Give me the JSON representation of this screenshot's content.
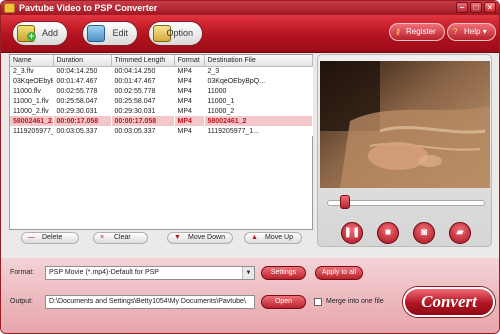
{
  "window": {
    "title": "Pavtube Video to PSP Converter",
    "minimize_glyph": "–",
    "maximize_glyph": "□",
    "close_glyph": "×"
  },
  "toolbar": {
    "add_label": "Add",
    "edit_label": "Edit",
    "option_label": "Option",
    "register_label": "Register",
    "help_label": "Help"
  },
  "file_table": {
    "columns": [
      "Name",
      "Duration",
      "Trimmed Length",
      "Format",
      "Destination File"
    ],
    "rows": [
      {
        "name": "2_3.flv",
        "duration": "00:04:14.250",
        "trimmed": "00:04:14.250",
        "format": "MP4",
        "dest": "2_3",
        "selected": false
      },
      {
        "name": "03KqeOEbyBpQ...",
        "duration": "00:01:47.467",
        "trimmed": "00:01:47.467",
        "format": "MP4",
        "dest": "03KqeOEbyBpQ...",
        "selected": false
      },
      {
        "name": "11000.flv",
        "duration": "00:02:55.778",
        "trimmed": "00:02:55.778",
        "format": "MP4",
        "dest": "11000",
        "selected": false
      },
      {
        "name": "11000_1.flv",
        "duration": "00:25:58.047",
        "trimmed": "00:25:58.047",
        "format": "MP4",
        "dest": "11000_1",
        "selected": false
      },
      {
        "name": "11000_2.flv",
        "duration": "00:29:30.031",
        "trimmed": "00:29:30.031",
        "format": "MP4",
        "dest": "11000_2",
        "selected": false
      },
      {
        "name": "58002461_2....",
        "duration": "00:00:17.058",
        "trimmed": "00:00:17.058",
        "format": "MP4",
        "dest": "58002461_2",
        "selected": true
      },
      {
        "name": "1119205977_1...",
        "duration": "00:03:05.337",
        "trimmed": "00:03:05.337",
        "format": "MP4",
        "dest": "1119205977_1...",
        "selected": false
      }
    ]
  },
  "list_buttons": {
    "delete_label": "Delete",
    "clear_label": "Clear",
    "move_down_label": "Move Down",
    "move_up_label": "Move Up"
  },
  "player": {
    "progress": 0.08
  },
  "settings": {
    "format_label": "Format:",
    "format_value": "PSP Movie (*.mp4)-Default for PSP",
    "settings_label": "Settings",
    "apply_all_label": "Apply to all",
    "output_label": "Output:",
    "output_value": "D:\\Documents and Settings\\Betty1054\\My Documents\\Pavtube\\",
    "open_label": "Open",
    "merge_label": "Merge into one file",
    "merge_checked": false,
    "convert_label": "Convert"
  },
  "colors": {
    "accent": "#b8222d",
    "selection": "#f3c7c9"
  }
}
